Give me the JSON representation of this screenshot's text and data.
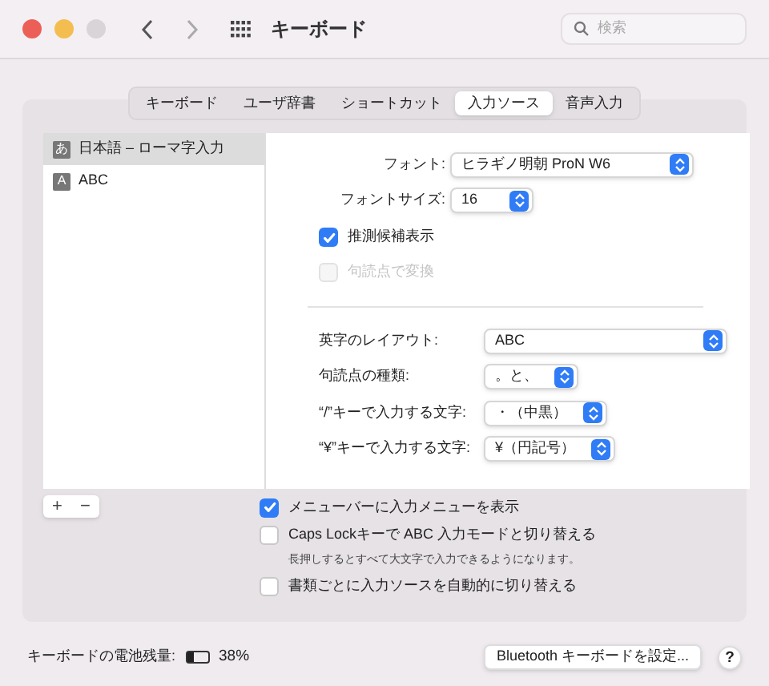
{
  "window": {
    "title": "キーボード",
    "search": {
      "placeholder": "検索"
    }
  },
  "tabs": [
    {
      "label": "キーボード",
      "selected": false
    },
    {
      "label": "ユーザ辞書",
      "selected": false
    },
    {
      "label": "ショートカット",
      "selected": false
    },
    {
      "label": "入力ソース",
      "selected": true
    },
    {
      "label": "音声入力",
      "selected": false
    }
  ],
  "sources": [
    {
      "badge": "あ",
      "label": "日本語 – ローマ字入力",
      "selected": true
    },
    {
      "badge": "A",
      "label": "ABC",
      "selected": false
    }
  ],
  "list_buttons": [
    "+",
    "−"
  ],
  "display_settings": [
    {
      "kind": "popup",
      "label": "フォント:",
      "value": "ヒラギノ明朝 ProN W6"
    },
    {
      "kind": "popup",
      "label": "フォントサイズ:",
      "value": "16"
    },
    {
      "kind": "checkbox",
      "label": "推測候補表示",
      "checked": true,
      "disabled": false
    },
    {
      "kind": "checkbox",
      "label": "句読点で変換",
      "checked": false,
      "disabled": true
    }
  ],
  "input_settings": [
    {
      "label": "英字のレイアウト:",
      "value": "ABC"
    },
    {
      "label": "句読点の種類:",
      "value": "。と、"
    },
    {
      "label": "“/”キーで入力する文字:",
      "value": "・（中黒）"
    },
    {
      "label": "“¥”キーで入力する文字:",
      "value": "¥（円記号）"
    }
  ],
  "options": [
    {
      "label": "メニューバーに入力メニューを表示",
      "checked": true
    },
    {
      "label": "Caps Lockキーで ABC 入力モードと切り替える",
      "checked": false,
      "note": "長押しするとすべて大文字で入力できるようになります。"
    },
    {
      "label": "書類ごとに入力ソースを自動的に切り替える",
      "checked": false
    }
  ],
  "battery": {
    "label": "キーボードの電池残量:",
    "level": 0.38,
    "reading": "38%"
  },
  "bluetooth_button": "Bluetooth キーボードを設定...",
  "help_button": "?"
}
